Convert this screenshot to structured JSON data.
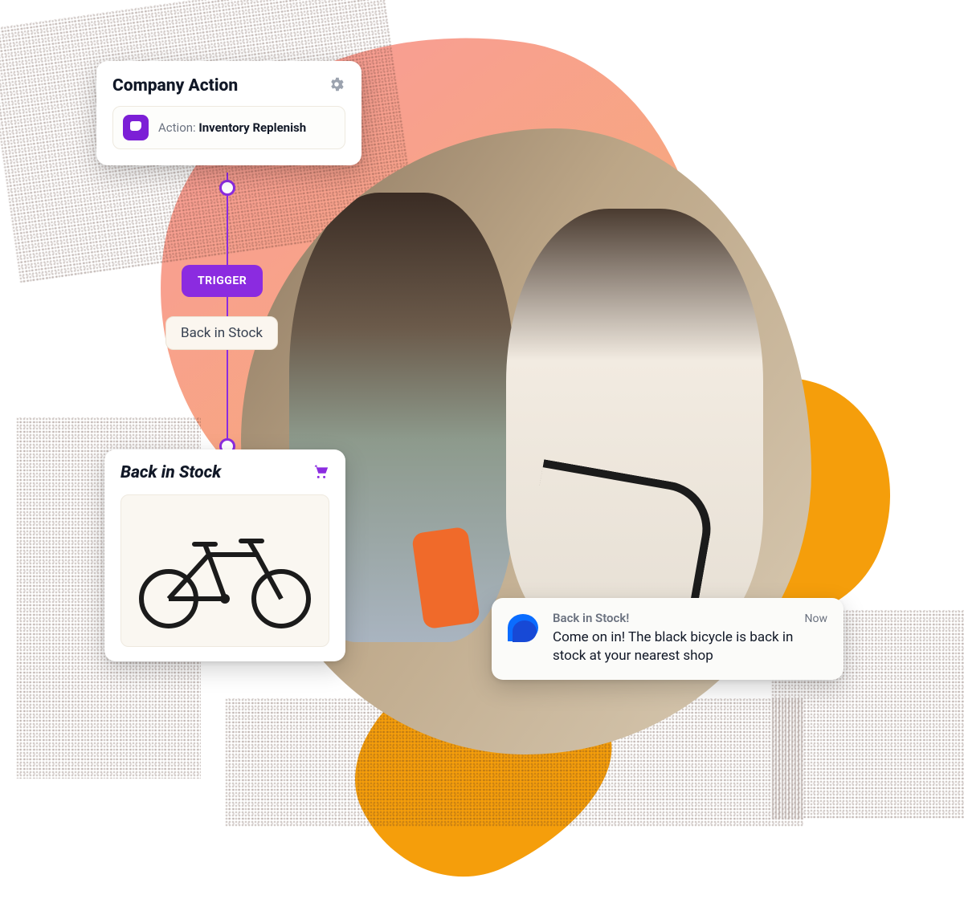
{
  "colors": {
    "purple": "#8b2be0",
    "orange": "#f59e0b"
  },
  "actionCard": {
    "title": "Company Action",
    "actionPrefix": "Action: ",
    "actionName": "Inventory Replenish"
  },
  "flow": {
    "triggerBadge": "TRIGGER",
    "triggerLabel": "Back in Stock"
  },
  "stockCard": {
    "title": "Back in Stock",
    "productAlt": "Black bicycle"
  },
  "notification": {
    "title": "Back in Stock!",
    "time": "Now",
    "message": "Come on in! The black bicycle is back in stock at your nearest shop"
  }
}
